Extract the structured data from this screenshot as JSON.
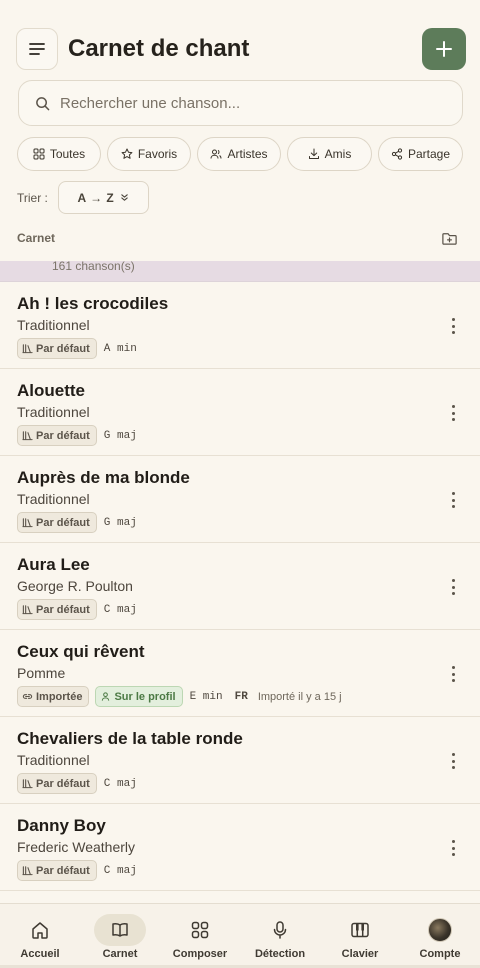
{
  "header": {
    "title": "Carnet de chant"
  },
  "search": {
    "placeholder": "Rechercher une chanson..."
  },
  "filters": [
    {
      "label": "Toutes",
      "icon": "grid-icon"
    },
    {
      "label": "Favoris",
      "icon": "star-icon"
    },
    {
      "label": "Artistes",
      "icon": "users-icon"
    },
    {
      "label": "Amis",
      "icon": "download-icon"
    },
    {
      "label": "Partage",
      "icon": "share-icon"
    }
  ],
  "sort": {
    "label": "Trier :",
    "value": "A → Z"
  },
  "section": {
    "label": "Carnet",
    "count": "161 chanson(s)"
  },
  "songs": [
    {
      "title": "Ah ! les crocodiles",
      "artist": "Traditionnel",
      "tag": "Par défaut",
      "key": "A min"
    },
    {
      "title": "Alouette",
      "artist": "Traditionnel",
      "tag": "Par défaut",
      "key": "G maj"
    },
    {
      "title": "Auprès de ma blonde",
      "artist": "Traditionnel",
      "tag": "Par défaut",
      "key": "G maj"
    },
    {
      "title": "Aura Lee",
      "artist": "George R. Poulton",
      "tag": "Par défaut",
      "key": "C maj"
    },
    {
      "title": "Ceux qui rêvent",
      "artist": "Pomme",
      "tag": "Importée",
      "tag2": "Sur le profil",
      "key": "E min",
      "lang": "FR",
      "imported": "Importé il y a 15 j"
    },
    {
      "title": "Chevaliers de la table ronde",
      "artist": "Traditionnel",
      "tag": "Par défaut",
      "key": "C maj"
    },
    {
      "title": "Danny Boy",
      "artist": "Frederic Weatherly",
      "tag": "Par défaut",
      "key": "C maj"
    }
  ],
  "nav": [
    {
      "label": "Accueil",
      "icon": "home-icon"
    },
    {
      "label": "Carnet",
      "icon": "book-icon",
      "active": true
    },
    {
      "label": "Composer",
      "icon": "grid-icon"
    },
    {
      "label": "Détection",
      "icon": "microphone-icon"
    },
    {
      "label": "Clavier",
      "icon": "piano-icon"
    },
    {
      "label": "Compte",
      "icon": "avatar"
    }
  ],
  "colors": {
    "background": "#faf6ee",
    "accent": "#5d7c5a",
    "count_bar": "#e6dbe3",
    "tag_green": "#e3efdd"
  }
}
